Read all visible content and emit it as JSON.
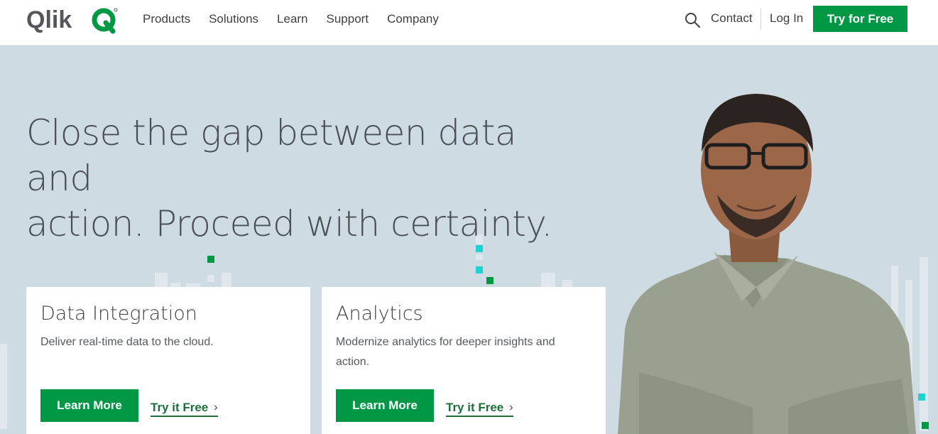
{
  "header": {
    "logo_text": "Qlik",
    "nav": [
      "Products",
      "Solutions",
      "Learn",
      "Support",
      "Company"
    ],
    "contact": "Contact",
    "login": "Log In",
    "cta": "Try for Free"
  },
  "hero": {
    "headline_line1": "Close the gap between data and",
    "headline_line2": "action. Proceed with certainty."
  },
  "cards": [
    {
      "title": "Data Integration",
      "description": "Deliver real-time data to the cloud.",
      "primary": "Learn More",
      "secondary": "Try it Free"
    },
    {
      "title": "Analytics",
      "description": "Modernize analytics for deeper insights and action.",
      "primary": "Learn More",
      "secondary": "Try it Free"
    }
  ],
  "colors": {
    "brand_green": "#009845",
    "hero_bg": "#cfdbe2",
    "accent_teal": "#1ed2d2",
    "text": "#404040"
  },
  "icons": [
    "qlik-logo",
    "search-icon",
    "chevron-right-icon"
  ]
}
